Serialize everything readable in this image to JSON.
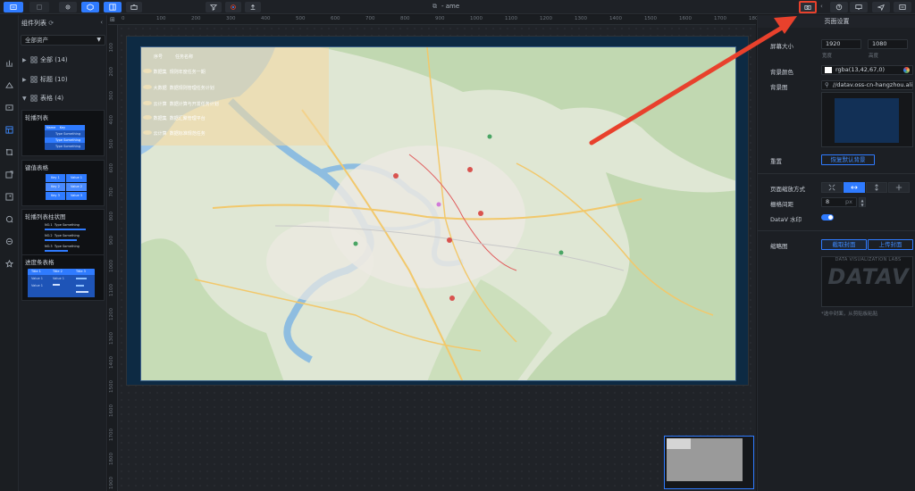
{
  "toolbar": {
    "doc_title": "- ame"
  },
  "component_panel": {
    "title": "组件列表",
    "asset_filter": "全部资产",
    "groups": [
      {
        "label": "全部 (14)"
      },
      {
        "label": "标题 (10)"
      },
      {
        "label": "表格 (4)"
      }
    ],
    "cards": [
      {
        "title": "轮播列表",
        "header_cells": [
          "Name",
          "Key"
        ],
        "rows": [
          "Type Something",
          "Type Something",
          "Type Something"
        ]
      },
      {
        "title": "键值表格",
        "pairs": [
          [
            "Key 1",
            "Value 1"
          ],
          [
            "Key 2",
            "Value 2"
          ],
          [
            "Key 3",
            "Value 3"
          ]
        ]
      },
      {
        "title": "轮播列表柱状图",
        "rows": [
          [
            "NO.1",
            "Type Something"
          ],
          [
            "NO.2",
            "Type Something"
          ],
          [
            "NO.3",
            "Type Something"
          ]
        ]
      },
      {
        "title": "进度条表格",
        "headers": [
          "Title 1",
          "Title 2",
          "Title 3"
        ],
        "values": [
          "Value 1",
          "Value 1",
          "Value 1"
        ]
      }
    ]
  },
  "ruler": {
    "top": [
      "0",
      "100",
      "200",
      "300",
      "400",
      "500",
      "600",
      "700",
      "800",
      "900",
      "1000",
      "1100",
      "1200",
      "1300",
      "1400",
      "1500",
      "1600",
      "1700",
      "1800"
    ],
    "left": [
      "100",
      "200",
      "300",
      "400",
      "500",
      "600",
      "700",
      "800",
      "900",
      "1000",
      "1100",
      "1200",
      "1300",
      "1400",
      "1500",
      "1600",
      "1700",
      "1800",
      "1900"
    ]
  },
  "map_overlay": {
    "header": [
      "序号",
      "任务名称"
    ],
    "rows": [
      [
        "数据集",
        "规则年度任务一期"
      ],
      [
        "大数据",
        "数据规则管理任务计划"
      ],
      [
        "云计算",
        "数据计算与开发任务计划"
      ],
      [
        "数据集",
        "数据汇聚管理平台"
      ],
      [
        "云计算",
        "数据标准规范任务"
      ]
    ]
  },
  "right_panel": {
    "title": "页面设置",
    "screen_size_label": "屏幕大小",
    "width_value": "1920",
    "height_value": "1080",
    "width_sub": "宽度",
    "height_sub": "高度",
    "bg_color_label": "背景颜色",
    "bg_color_value": "rgba(13,42,67,0)",
    "bg_image_label": "背景图",
    "bg_image_url": "//datav.oss-cn-hangzhou.aliyu",
    "reset_label": "重置",
    "reset_button": "恢复默认背景",
    "scale_mode_label": "页面缩放方式",
    "grid_label": "栅格间距",
    "grid_value": "8",
    "grid_unit": "px",
    "watermark_label": "DataV 水印",
    "watermark_on": true,
    "thumbnail_label": "缩略图",
    "capture_button": "截取封面",
    "upload_button": "上传封面",
    "thumb_caption": "DATA VISUALIZATION LABS",
    "thumb_logo": "DATAV",
    "thumb_hint": "*选中封面，从剪贴板粘贴"
  },
  "colors": {
    "accent": "#2f7bff",
    "highlight": "#e8412c",
    "screen_bg": "#0d2a43"
  }
}
